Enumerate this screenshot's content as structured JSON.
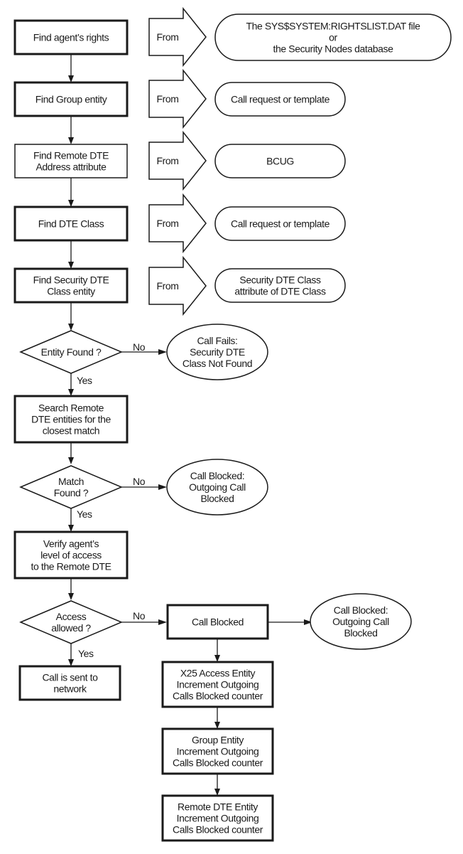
{
  "diagram": {
    "title": "",
    "process": {
      "find_rights": [
        "Find agent’s rights"
      ],
      "find_group": [
        "Find Group entity"
      ],
      "find_remote_dte": [
        "Find Remote DTE",
        "Address attribute"
      ],
      "find_dte_class": [
        "Find DTE Class"
      ],
      "find_security_class": [
        "Find Security DTE",
        "Class entity"
      ],
      "search_remote": [
        "Search Remote",
        "DTE entities for the",
        "closest match"
      ],
      "verify_access": [
        "Verify agent’s",
        "level of access",
        "to the Remote DTE"
      ],
      "call_sent": [
        "Call is sent to",
        "network"
      ],
      "call_blocked": [
        "Call Blocked"
      ],
      "x25_counter": [
        "X25 Access Entity",
        "Increment Outgoing",
        "Calls Blocked counter"
      ],
      "group_counter": [
        "Group Entity",
        "Increment Outgoing",
        "Calls Blocked counter"
      ],
      "remote_counter": [
        "Remote DTE Entity",
        "Increment Outgoing",
        "Calls Blocked counter"
      ]
    },
    "from_label": "From",
    "sources": {
      "rights": [
        "The SYS$SYSTEM:RIGHTSLIST.DAT file",
        "or",
        "the Security Nodes database"
      ],
      "group": [
        "Call request or template"
      ],
      "remote_dte": [
        "BCUG"
      ],
      "dte_class": [
        "Call request or template"
      ],
      "security_class": [
        "Security DTE Class",
        "attribute of DTE Class"
      ]
    },
    "decisions": {
      "entity_found": [
        "Entity Found ?"
      ],
      "match_found": [
        "Match",
        "Found ?"
      ],
      "access_allowed": [
        "Access",
        "allowed ?"
      ]
    },
    "outcomes": {
      "call_fails": [
        "Call Fails:",
        "Security DTE",
        "Class Not Found"
      ],
      "blocked_match": [
        "Call Blocked:",
        "Outgoing Call",
        "Blocked"
      ],
      "blocked_access": [
        "Call Blocked:",
        "Outgoing Call",
        "Blocked"
      ]
    },
    "edge_labels": {
      "yes": "Yes",
      "no": "No"
    }
  }
}
